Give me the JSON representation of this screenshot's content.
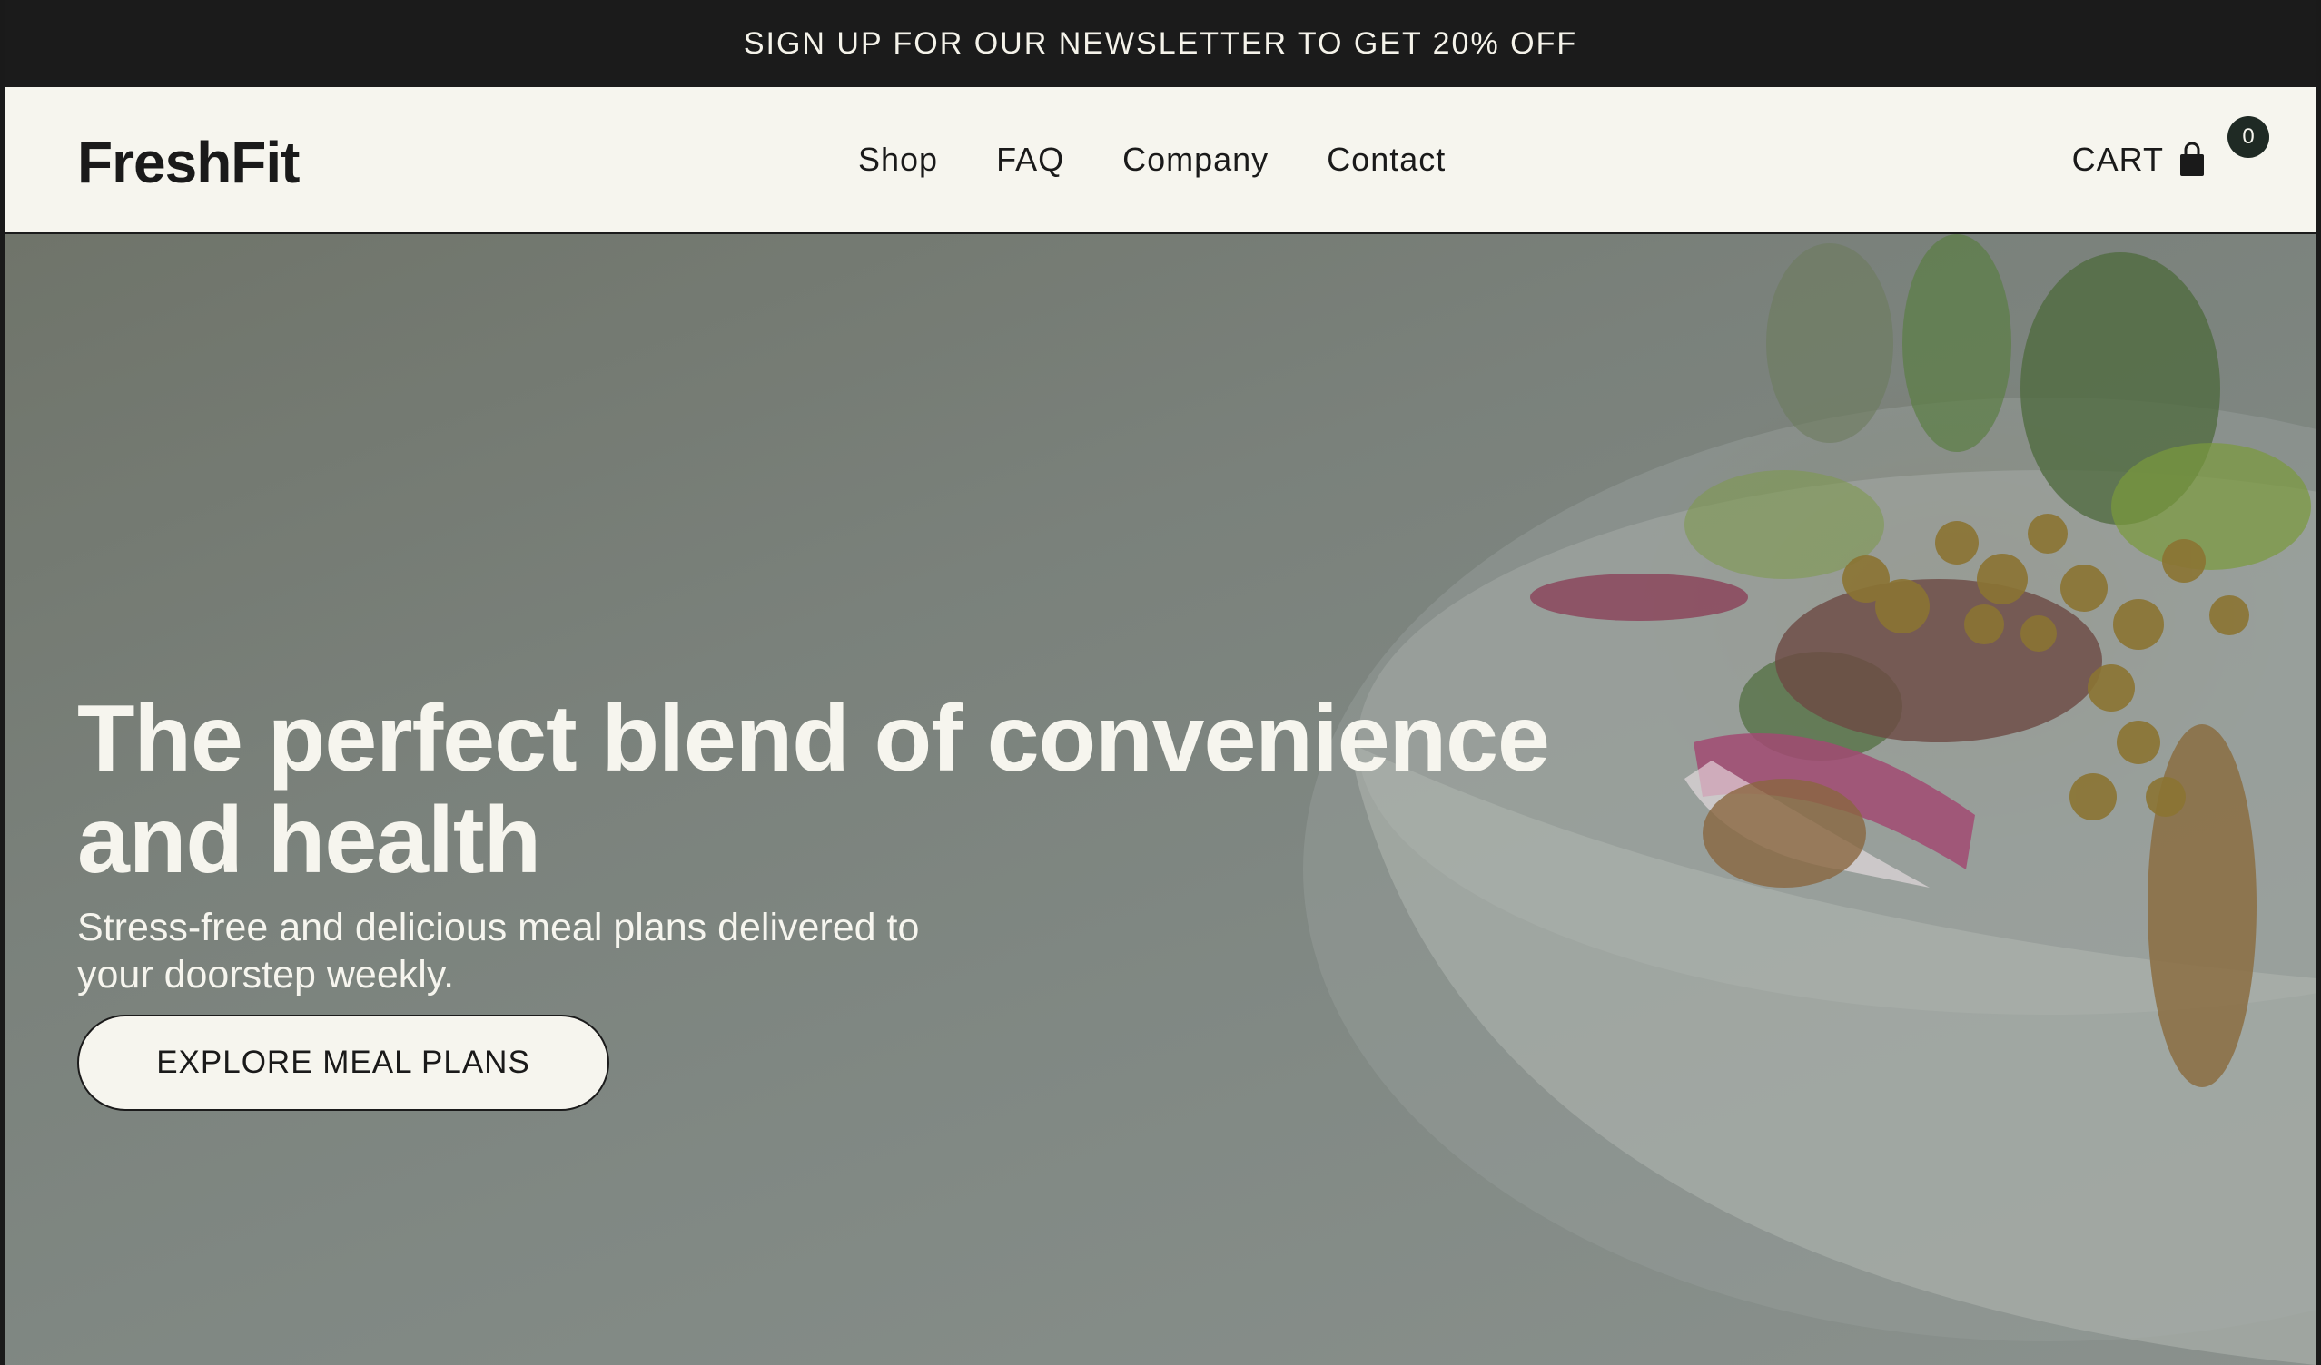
{
  "announcement": {
    "text": "SIGN UP FOR OUR NEWSLETTER TO GET 20% OFF"
  },
  "header": {
    "logo": "FreshFit",
    "nav": [
      {
        "label": "Shop"
      },
      {
        "label": "FAQ"
      },
      {
        "label": "Company"
      },
      {
        "label": "Contact"
      }
    ],
    "cart": {
      "label": "CART",
      "count": "0",
      "icon": "shopping-bag-icon"
    }
  },
  "hero": {
    "title": "The perfect blend of convenience and health",
    "subtitle": "Stress-free and delicious meal plans delivered to your doorstep weekly.",
    "cta_label": "EXPLORE MEAL PLANS",
    "image": "salad-bowl-photo"
  },
  "colors": {
    "announcement_bg": "#1b1b1b",
    "header_bg": "#f6f5ee",
    "text_dark": "#1a1a1a",
    "text_light": "#f6f5ee",
    "hero_overlay": "#7f8883",
    "badge_bg": "#1f2a24"
  }
}
